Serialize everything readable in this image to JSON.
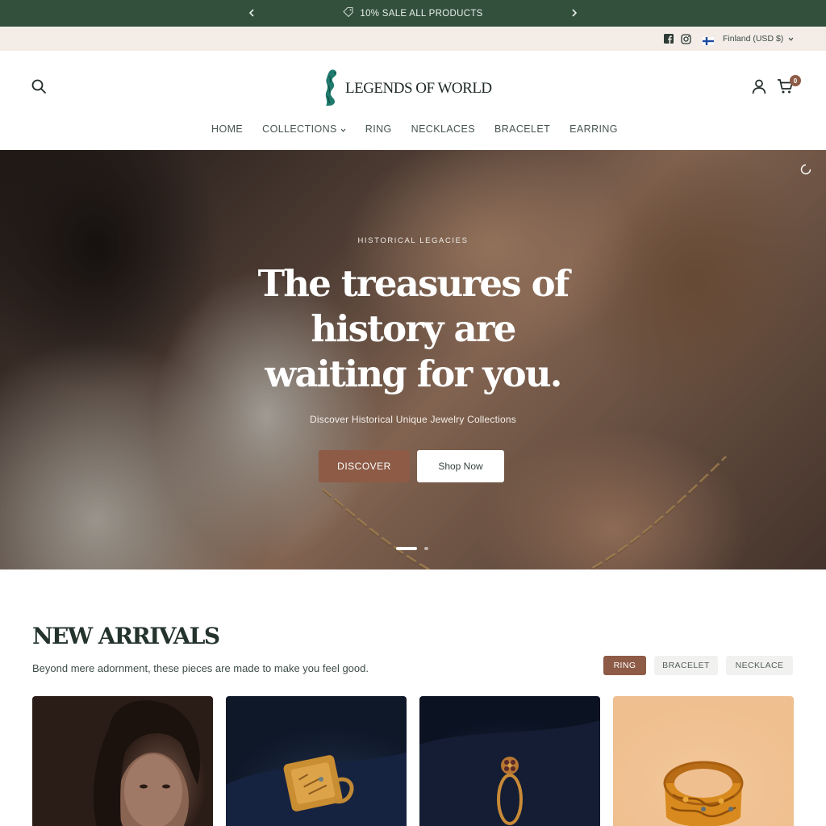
{
  "announcement": {
    "prev_icon": "chevron-left-icon",
    "next_icon": "chevron-right-icon",
    "tag_icon": "tag-icon",
    "text": "10% SALE ALL PRODUCTS"
  },
  "utility": {
    "social": [
      "facebook-icon",
      "instagram-icon"
    ],
    "flag": "finland-flag",
    "locale": "Finland (USD $)"
  },
  "header": {
    "brand": "LEGENDS OF WORLD",
    "cart_count": "0",
    "nav": [
      {
        "label": "HOME"
      },
      {
        "label": "COLLECTIONS",
        "has_dropdown": true
      },
      {
        "label": "RING"
      },
      {
        "label": "NECKLACES"
      },
      {
        "label": "BRACELET"
      },
      {
        "label": "EARRING"
      }
    ]
  },
  "hero": {
    "eyebrow": "HISTORICAL LEGACIES",
    "headline_lines": [
      "The treasures of",
      "history are",
      "waiting for you."
    ],
    "subtitle": "Discover Historical Unique Jewelry Collections",
    "primary_button": "DISCOVER",
    "secondary_button": "Shop Now",
    "slides_total": 2,
    "active_slide": 1
  },
  "arrivals": {
    "title": "NEW ARRIVALS",
    "subtitle": "Beyond mere adornment, these pieces are made to make you feel good.",
    "filters": [
      {
        "label": "RING",
        "active": true
      },
      {
        "label": "BRACELET",
        "active": false
      },
      {
        "label": "NECKLACE",
        "active": false
      }
    ]
  },
  "colors": {
    "announcement_bg": "#33503d",
    "utility_bg": "#f3ece7",
    "accent": "#8d5b46",
    "text_dark": "#24332c"
  }
}
